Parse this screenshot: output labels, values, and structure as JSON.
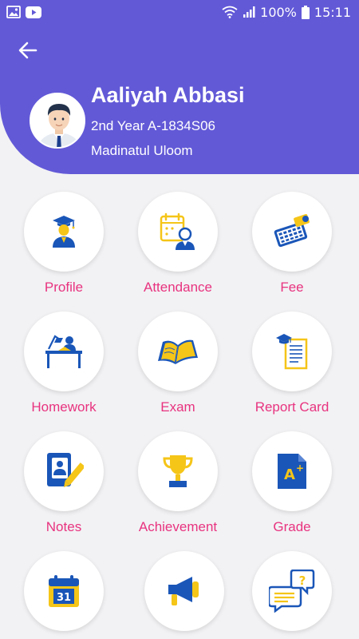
{
  "status_bar": {
    "battery": "100%",
    "time": "15:11",
    "icons": [
      "image-icon",
      "youtube-icon",
      "wifi-icon",
      "signal-icon",
      "battery-icon"
    ]
  },
  "header": {
    "back_icon": "arrow-left-icon",
    "name": "Aaliyah Abbasi",
    "class_info": "2nd Year A-1834S06",
    "school": "Madinatul Uloom",
    "avatar_icon": "student-avatar-icon"
  },
  "colors": {
    "header": "#6259d7",
    "label": "#e8337f",
    "icon_blue": "#1a56b8",
    "icon_yellow": "#f5c518"
  },
  "menu": [
    {
      "label": "Profile",
      "icon": "graduate-icon"
    },
    {
      "label": "Attendance",
      "icon": "attendance-calendar-icon"
    },
    {
      "label": "Fee",
      "icon": "calculator-icon"
    },
    {
      "label": "Homework",
      "icon": "study-desk-icon"
    },
    {
      "label": "Exam",
      "icon": "open-book-icon"
    },
    {
      "label": "Report Card",
      "icon": "report-card-icon"
    },
    {
      "label": "Notes",
      "icon": "notes-icon"
    },
    {
      "label": "Achievement",
      "icon": "trophy-icon"
    },
    {
      "label": "Grade",
      "icon": "grade-a-plus-icon"
    },
    {
      "label": "",
      "icon": "calendar-31-icon",
      "calendar_text": "31"
    },
    {
      "label": "",
      "icon": "megaphone-icon"
    },
    {
      "label": "",
      "icon": "chat-question-icon",
      "chat_text": "?"
    }
  ]
}
